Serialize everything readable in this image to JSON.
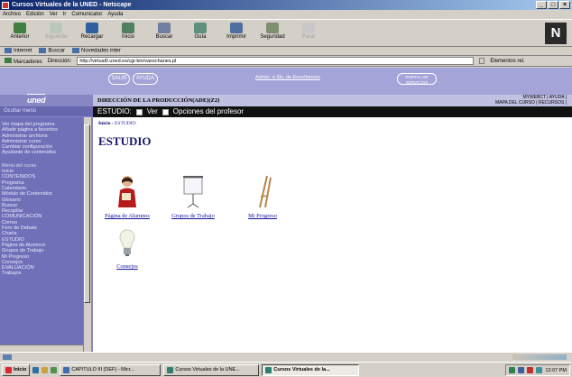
{
  "window": {
    "title": "Cursos Virtuales de la UNED - Netscape"
  },
  "menubar": [
    "Archivo",
    "Edición",
    "Ver",
    "Ir",
    "Comunicator",
    "Ayuda"
  ],
  "toolbar": [
    "Anterior",
    "Siguiente",
    "Recargar",
    "Inicio",
    "Buscar",
    "Guía",
    "Imprimir",
    "Seguridad",
    "Parar"
  ],
  "personal_bar": [
    "Internet",
    "Buscar",
    "Novedades inter"
  ],
  "location": {
    "bookmarks_label": "Marcadores",
    "label": "Dirección:",
    "url": "http://virtual0.uned.es/cgi-bin/vaxochanes.pl",
    "related": "Elementos rel."
  },
  "banner": {
    "salir": "SALIR",
    "ayuda": "AYUDA",
    "link": "Admin. a Sis. de Enseñanzas",
    "right": "PORTAL DE SERVICIOS"
  },
  "sidebar": {
    "logo": "uned",
    "ocultar": "Ocultar menú",
    "top_items": [
      "Ver mapa del programa",
      "Añadir página a favoritos",
      "Administrar archivos",
      "Administrar curso",
      "Cambiar configuración",
      "Ayudante de contenidos"
    ],
    "menu_title": "Menú del curso",
    "menu_items": [
      "Inicio",
      "CONTENIDOS",
      "Programa",
      "Calendario",
      "Módulo de Contenidos",
      "Glosario",
      "Buscar",
      "Recopilar",
      "COMUNICACIÓN",
      "Correo",
      "Foro de Debate",
      "Charla",
      "ESTUDIO",
      "Página de Alumnos",
      "Grupos de Trabajo",
      "Mi Progreso",
      "Consejos",
      "EVALUACIÓN",
      "Trabajos"
    ]
  },
  "main": {
    "direction": "DIRECCIÓN DE LA PRODUCCIÓN(ADE)(Z2)",
    "top_links": [
      "MYWEBCT | AYUDA |",
      "MAPA DEL CURSO | RECURSOS |"
    ],
    "estudio": "ESTUDIO:",
    "ver": "Ver",
    "opciones": "Opciones del profesor",
    "crumb_home": "Inicio",
    "crumb_sep": "›",
    "crumb_current": "ESTUDIO",
    "heading": "ESTUDIO",
    "items": [
      {
        "label": "Página de Alumnos",
        "icon": "student-icon"
      },
      {
        "label": "Grupos de Trabajo",
        "icon": "projection-screen-icon"
      },
      {
        "label": "Mi Progreso",
        "icon": "easel-icon"
      },
      {
        "label": "Consejos",
        "icon": "lightbulb-icon"
      }
    ]
  },
  "taskbar": {
    "start": "Inicio",
    "tasks": [
      "CAPITULO III (DEF) - Micr...",
      "Cursos Virtuales de la UNE...",
      "Cursos Virtuales de la..."
    ],
    "clock": "12:07 PM"
  }
}
